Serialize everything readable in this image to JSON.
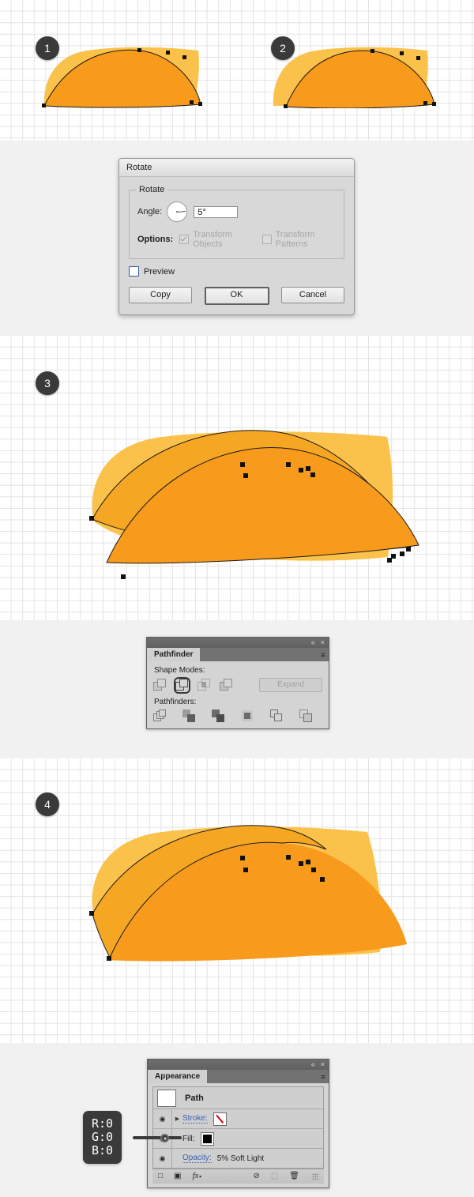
{
  "sections": {
    "steps": [
      {
        "number": "1"
      },
      {
        "number": "2"
      },
      {
        "number": "3"
      },
      {
        "number": "4"
      }
    ]
  },
  "artwork": {
    "colors": {
      "light_orange": "#FBC council",
      "base_light": "#FBC24B",
      "base_mid": "#F99B1C",
      "dome_dark": "#F7941E",
      "sliver": "#F6A623",
      "anchor": "#111111",
      "path_stroke": "#1a1a1a"
    }
  },
  "rotate_dialog": {
    "title": "Rotate",
    "fieldset_legend": "Rotate",
    "angle_label": "Angle:",
    "angle_value": "5°",
    "options_label": "Options:",
    "transform_objects_label": "Transform Objects",
    "transform_objects_checked": true,
    "transform_patterns_label": "Transform Patterns",
    "transform_patterns_checked": false,
    "preview_label": "Preview",
    "preview_checked": false,
    "buttons": {
      "copy": "Copy",
      "ok": "OK",
      "cancel": "Cancel"
    }
  },
  "pathfinder_panel": {
    "tab_label": "Pathfinder",
    "shape_modes_label": "Shape Modes:",
    "pathfinders_label": "Pathfinders:",
    "expand_label": "Expand",
    "selected_shape_mode_index": 1,
    "shape_mode_names": [
      "unite",
      "minus-front",
      "intersect",
      "exclude"
    ],
    "pathfinder_names": [
      "divide",
      "trim",
      "merge",
      "crop",
      "outline",
      "minus-back"
    ],
    "collapse_icon": "«",
    "close_icon": "×",
    "menu_icon": "≡"
  },
  "appearance_panel": {
    "tab_label": "Appearance",
    "path_label": "Path",
    "stroke_label": "Stroke:",
    "fill_label": "Fill:",
    "opacity_label": "Opacity:",
    "opacity_value": "5% Soft Light",
    "eye_icon": "◉",
    "triangle_icon": "▶",
    "collapse_icon": "«",
    "close_icon": "×",
    "menu_icon": "≡",
    "bottom_icons": [
      "new-stroke",
      "new-fill",
      "fx",
      "clear-appearance",
      "duplicate",
      "delete"
    ],
    "fill_color": "#000000"
  },
  "rgb_callout": {
    "r_line": "R:0",
    "g_line": "G:0",
    "b_line": "B:0"
  }
}
